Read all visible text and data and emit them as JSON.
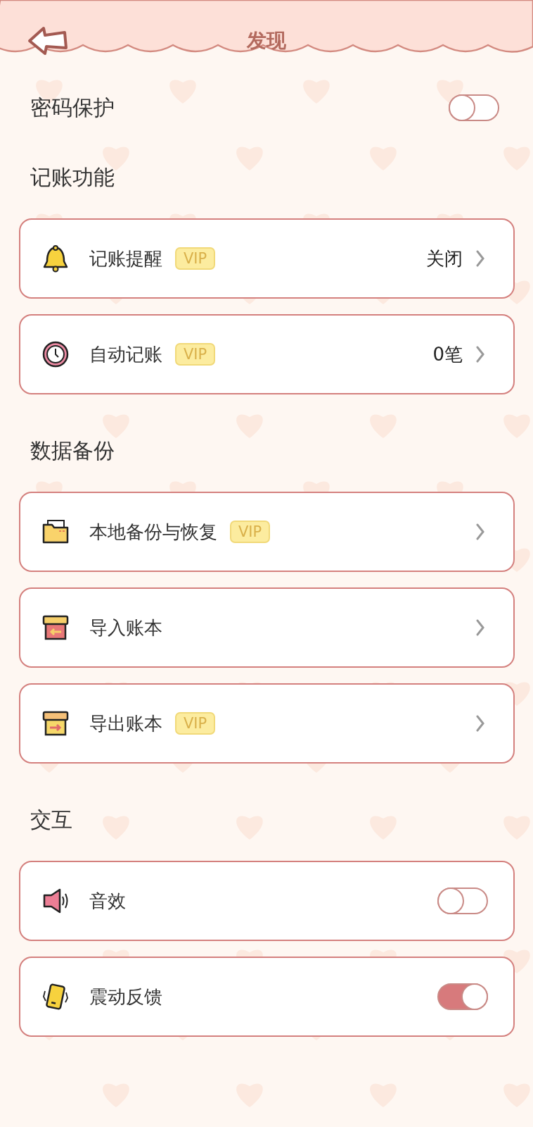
{
  "header": {
    "title": "发现"
  },
  "password_protection": {
    "label": "密码保护",
    "on": false
  },
  "sections": [
    {
      "title": "记账功能",
      "items": [
        {
          "kind": "link",
          "label": "记账提醒",
          "vip": "VIP",
          "value": "关闭"
        },
        {
          "kind": "link",
          "label": "自动记账",
          "vip": "VIP",
          "value": "0笔"
        }
      ]
    },
    {
      "title": "数据备份",
      "items": [
        {
          "kind": "link",
          "label": "本地备份与恢复",
          "vip": "VIP"
        },
        {
          "kind": "link",
          "label": "导入账本"
        },
        {
          "kind": "link",
          "label": "导出账本",
          "vip": "VIP"
        }
      ]
    },
    {
      "title": "交互",
      "items": [
        {
          "kind": "toggle",
          "label": "音效",
          "on": false
        },
        {
          "kind": "toggle",
          "label": "震动反馈",
          "on": true
        }
      ]
    }
  ]
}
